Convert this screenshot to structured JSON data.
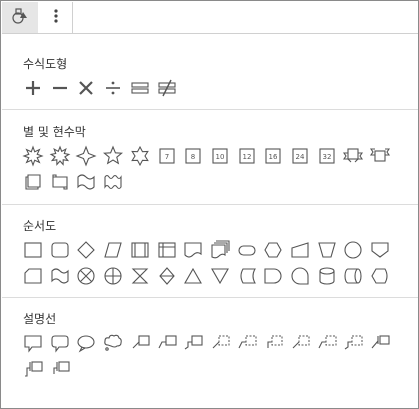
{
  "toolbar": {
    "shapes_icon": "shapes-icon",
    "more_icon": "more-vertical-icon"
  },
  "sections": [
    {
      "title": "수식도형",
      "shapes": [
        "plus",
        "minus",
        "multiply",
        "divide",
        "equal",
        "not-equal"
      ]
    },
    {
      "title": "별 및 현수막",
      "shapes": [
        "explosion-1",
        "explosion-2",
        "star-4",
        "star-5",
        "star-6",
        "star-7",
        "star-8",
        "star-10",
        "star-12",
        "star-16",
        "star-24",
        "star-32",
        "ribbon-down",
        "ribbon-up",
        "scroll-vertical",
        "scroll-horizontal",
        "wave",
        "double-wave"
      ],
      "badge_numbers": {
        "star-7": "7",
        "star-8": "8",
        "star-10": "10",
        "star-12": "12",
        "star-16": "16",
        "star-24": "24",
        "star-32": "32"
      }
    },
    {
      "title": "순서도",
      "shapes": [
        "process",
        "alternate-process",
        "decision",
        "data",
        "predefined-process",
        "internal-storage",
        "document",
        "multidocument",
        "terminator",
        "preparation",
        "manual-input",
        "manual-operation",
        "connector",
        "offpage-connector",
        "card",
        "punched-tape",
        "summing-junction",
        "or",
        "collate",
        "sort",
        "extract",
        "merge",
        "stored-data",
        "delay",
        "sequential-access-storage",
        "magnetic-disk",
        "direct-access-storage",
        "display"
      ]
    },
    {
      "title": "설명선",
      "shapes": [
        "callout-rectangle",
        "callout-rounded-rectangle",
        "callout-oval",
        "callout-cloud",
        "line-callout-1",
        "line-callout-2",
        "line-callout-3",
        "line-callout-1-no-border",
        "line-callout-2-no-border",
        "line-callout-3-no-border",
        "line-callout-1-accent",
        "line-callout-2-accent",
        "line-callout-3-accent",
        "line-callout-1-border-accent",
        "line-callout-2-border-accent",
        "line-callout-3-border-accent"
      ]
    }
  ]
}
